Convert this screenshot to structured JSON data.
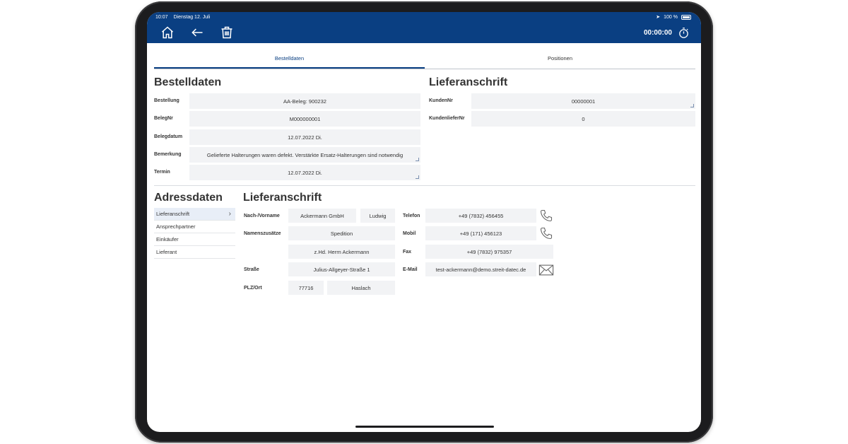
{
  "status": {
    "time": "10:07",
    "date": "Dienstag 12. Juli",
    "battery": "100 %"
  },
  "navbar": {
    "home_icon": "home-icon",
    "back_icon": "arrow-left-icon",
    "delete_icon": "trash-icon",
    "timer_value": "00:00:00",
    "timer_icon": "stopwatch-icon"
  },
  "tabs": [
    {
      "label": "Bestelldaten",
      "active": true
    },
    {
      "label": "Positionen",
      "active": false
    }
  ],
  "bestelldaten": {
    "title": "Bestelldaten",
    "fields": [
      {
        "label": "Bestellung",
        "value": "AA-Beleg: 900232"
      },
      {
        "label": "BelegNr",
        "value": "M000000001"
      },
      {
        "label": "Belegdatum",
        "value": "12.07.2022 Di."
      },
      {
        "label": "Bemerkung",
        "value": "Gelieferte Halterungen waren defekt. Verstärkte Ersatz-Halterungen sind notwendig"
      },
      {
        "label": "Termin",
        "value": "12.07.2022 Di."
      }
    ]
  },
  "lieferanschrift_top": {
    "title": "Lieferanschrift",
    "fields": [
      {
        "label": "KundenNr",
        "value": "00000001"
      },
      {
        "label": "KundenlieferNr",
        "value": "0"
      }
    ]
  },
  "adressdaten": {
    "title": "Adressdaten",
    "items": [
      {
        "label": "Lieferanschrift",
        "active": true
      },
      {
        "label": "Ansprechpartner",
        "active": false
      },
      {
        "label": "Einkäufer",
        "active": false
      },
      {
        "label": "Lieferant",
        "active": false
      }
    ]
  },
  "address": {
    "title": "Lieferanschrift",
    "name_label": "Nach-/Vorname",
    "last_name": "Ackermann GmbH",
    "first_name": "Ludwig",
    "zusatz_label": "Namenszusätze",
    "zusatz1": "Spedition",
    "zusatz2": "z.Hd. Herrn Ackermann",
    "strasse_label": "Straße",
    "strasse": "Julius-Allgeyer-Straße 1",
    "plzort_label": "PLZ/Ort",
    "plz": "77716",
    "ort": "Haslach",
    "telefon_label": "Telefon",
    "telefon": "+49 (7832) 456455",
    "mobil_label": "Mobil",
    "mobil": "+49 (171) 456123",
    "fax_label": "Fax",
    "fax": "+49 (7832) 975357",
    "email_label": "E-Mail",
    "email": "test-ackermann@demo.streit-datec.de"
  },
  "colors": {
    "primary": "#0a3f82",
    "field_bg": "#f2f3f5"
  }
}
